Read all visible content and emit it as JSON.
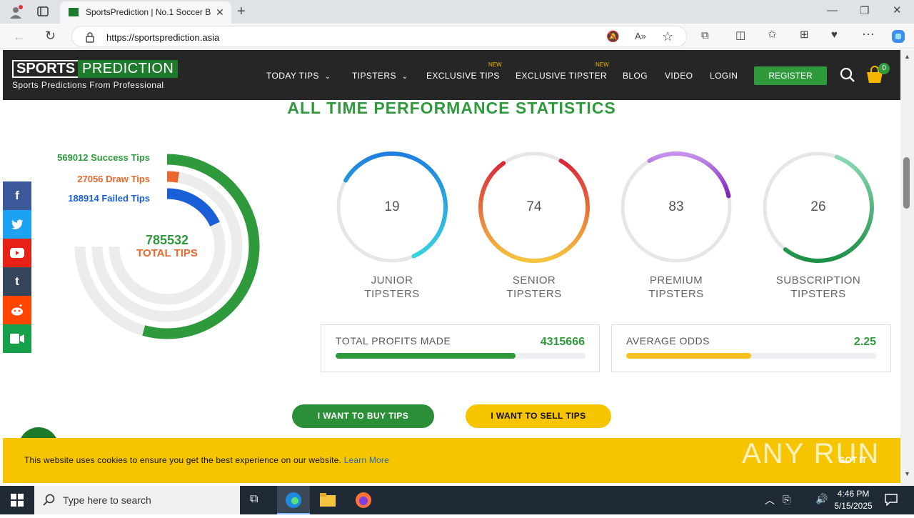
{
  "browser": {
    "tab_title": "SportsPrediction | No.1 Soccer Be",
    "url": "https://sportsprediction.asia"
  },
  "site": {
    "logo_sports": "SPORTS",
    "logo_prediction": "PREDICTION",
    "logo_tagline": "Sports Predictions From Professional",
    "nav": {
      "today_tips": "TODAY TIPS",
      "tipsters": "TIPSTERS",
      "exclusive_tips": "EXCLUSIVE TIPS",
      "exclusive_tipster": "EXCLUSIVE TIPSTER",
      "new_badge": "NEW",
      "blog": "BLOG",
      "video": "VIDEO",
      "login": "LOGIN",
      "register": "REGISTER",
      "cart_count": "0"
    }
  },
  "stats": {
    "heading": "ALL TIME PERFORMANCE STATISTICS",
    "success_tips": "569012 Success Tips",
    "draw_tips": "27056 Draw Tips",
    "failed_tips": "188914 Failed Tips",
    "total_tips_value": "785532",
    "total_tips_label": "TOTAL TIPS",
    "colors": {
      "success": "#2e9a3c",
      "draw": "#e9682c",
      "failed": "#1a5fd8",
      "track": "#ececec"
    },
    "rings": {
      "success_fraction": 0.7244,
      "draw_fraction": 0.0344,
      "failed_fraction": 0.2405
    },
    "tipsters": [
      {
        "value": "19",
        "label_1": "JUNIOR",
        "label_2": "TIPSTERS",
        "fraction": 0.6,
        "colors": [
          "#1f7fde",
          "#36d3e0"
        ]
      },
      {
        "value": "74",
        "label_1": "SENIOR",
        "label_2": "TIPSTERS",
        "fraction": 0.82,
        "colors": [
          "#d9263a",
          "#f6c43e"
        ]
      },
      {
        "value": "83",
        "label_1": "PREMIUM",
        "label_2": "TIPSTERS",
        "fraction": 0.3,
        "colors": [
          "#c793ec",
          "#7d1fb8"
        ]
      },
      {
        "value": "26",
        "label_1": "SUBSCRIPTION",
        "label_2": "TIPSTERS",
        "fraction": 0.55,
        "colors": [
          "#8ad9b1",
          "#1d8f47"
        ]
      }
    ],
    "total_profits_label": "TOTAL PROFITS MADE",
    "total_profits_value": "4315666",
    "total_profits_fraction": 0.72,
    "average_odds_label": "AVERAGE ODDS",
    "average_odds_value": "2.25",
    "average_odds_fraction": 0.5
  },
  "cta": {
    "buy": "I WANT TO BUY TIPS",
    "sell": "I WANT TO SELL TIPS"
  },
  "cookie": {
    "text": "This website uses cookies to ensure you get the best experience on our website.",
    "link": "Learn More",
    "button": "GOT IT",
    "watermark": "ANY RUN"
  },
  "taskbar": {
    "search_placeholder": "Type here to search",
    "time": "4:46 PM",
    "date": "5/15/2025"
  }
}
